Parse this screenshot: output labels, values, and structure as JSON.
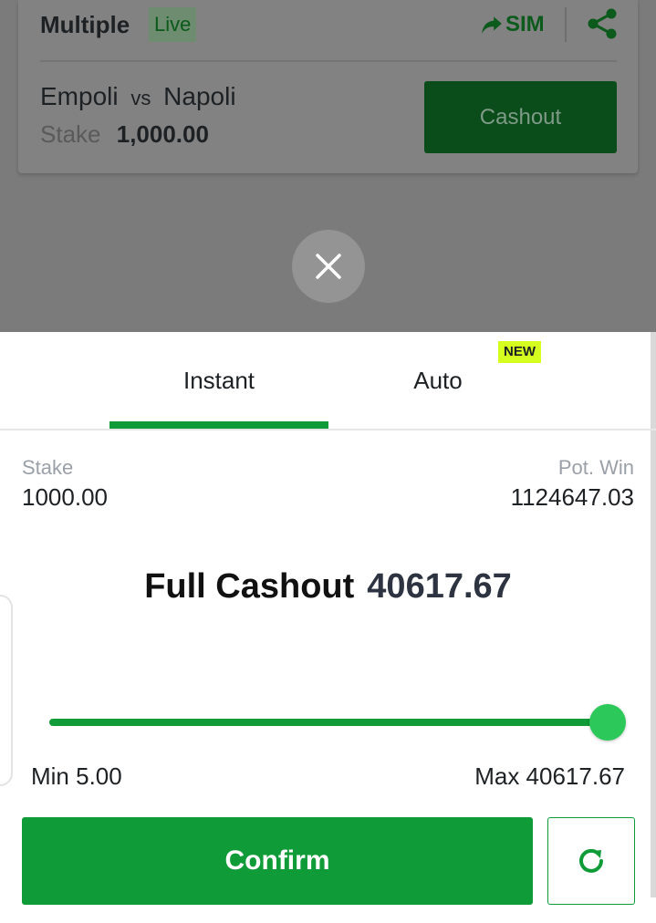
{
  "bet_card": {
    "title": "Multiple",
    "live_badge": "Live",
    "sim_label": "SIM",
    "home_team": "Empoli",
    "vs": "vs",
    "away_team": "Napoli",
    "stake_label": "Stake",
    "stake_value": "1,000.00",
    "cashout_label": "Cashout"
  },
  "icons": {
    "share": "share-icon",
    "sim": "forward-arrow-icon",
    "close": "close-icon",
    "refresh": "refresh-icon"
  },
  "tabs": [
    {
      "label": "Instant",
      "active": true
    },
    {
      "label": "Auto",
      "active": false,
      "badge": "NEW"
    }
  ],
  "summary": {
    "stake_label": "Stake",
    "stake_value": "1000.00",
    "pot_win_label": "Pot. Win",
    "pot_win_value": "1124647.03"
  },
  "cashout": {
    "label": "Full Cashout",
    "amount": "40617.67",
    "slider_fraction": 1.0,
    "min_label": "Min 5.00",
    "max_label": "Max 40617.67"
  },
  "actions": {
    "confirm_label": "Confirm"
  },
  "colors": {
    "primary_green": "#0f9b38",
    "slider_thumb": "#2cc95a",
    "new_badge": "#d4ff1f"
  }
}
